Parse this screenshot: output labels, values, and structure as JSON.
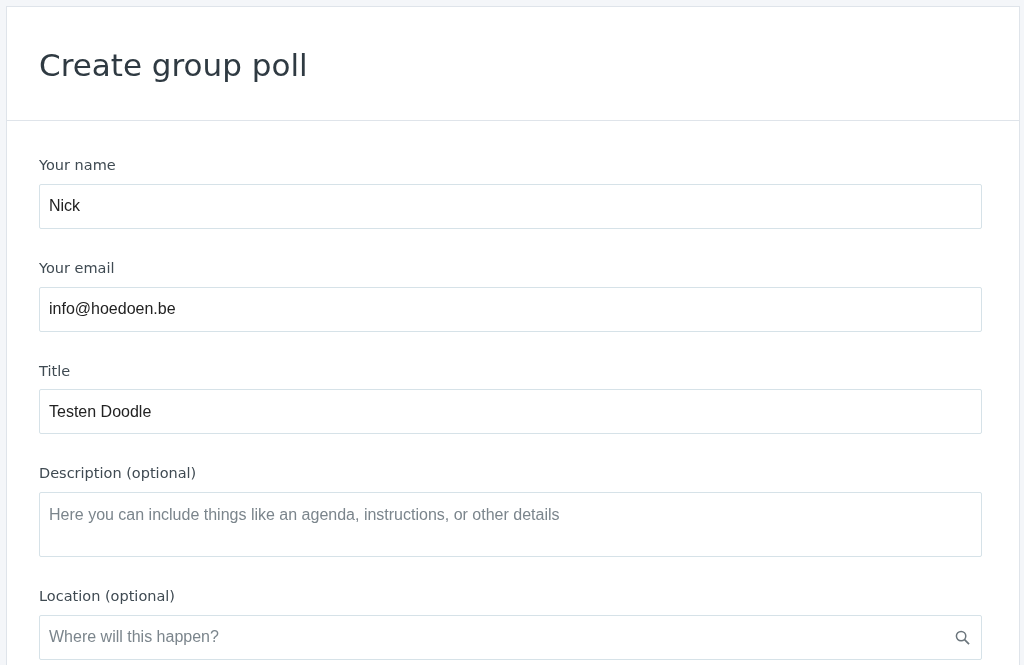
{
  "title": "Create group poll",
  "fields": [
    {
      "kind": "input",
      "label": "Your name",
      "value": "Nick"
    },
    {
      "kind": "input",
      "label": "Your email",
      "value": "info@hoedoen.be"
    },
    {
      "kind": "input",
      "label": "Title",
      "value": "Testen Doodle"
    },
    {
      "kind": "textarea",
      "label": "Description (optional)",
      "placeholder": "Here you can include things like an agenda, instructions, or other details"
    },
    {
      "kind": "search",
      "label": "Location (optional)",
      "placeholder": "Where will this happen?"
    }
  ]
}
